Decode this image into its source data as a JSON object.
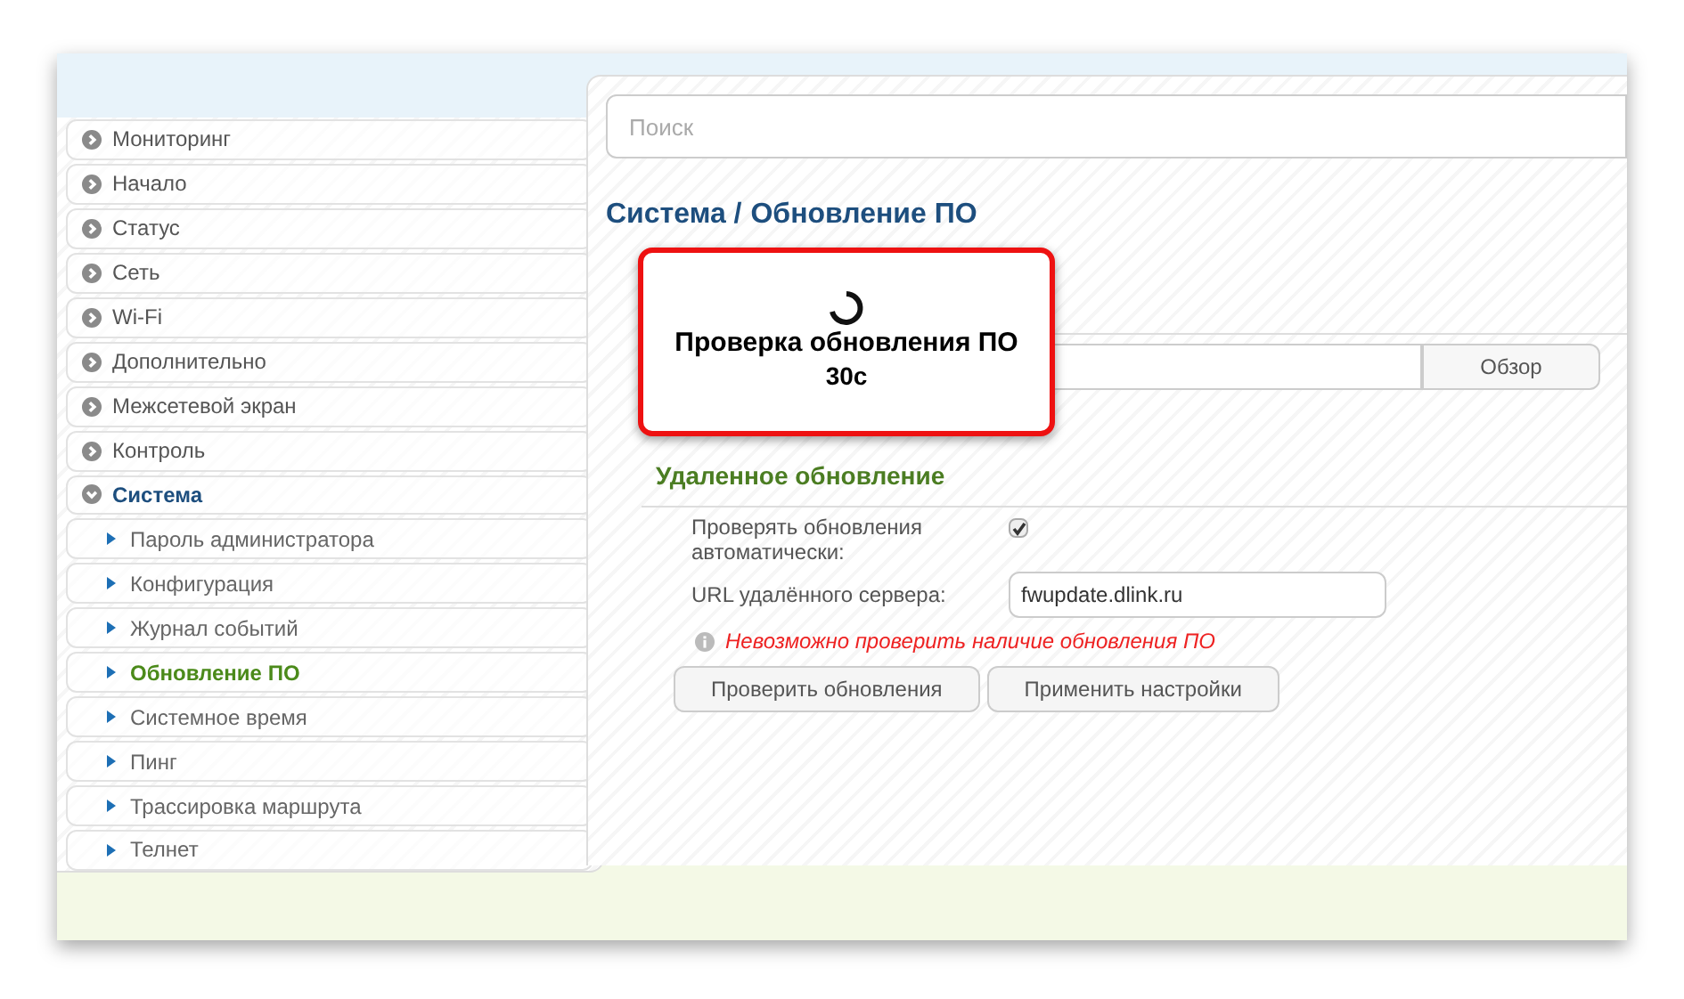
{
  "sidebar": {
    "items": [
      {
        "label": "Мониторинг",
        "selected": false,
        "expanded": false
      },
      {
        "label": "Начало",
        "selected": false,
        "expanded": false
      },
      {
        "label": "Статус",
        "selected": false,
        "expanded": false
      },
      {
        "label": "Сеть",
        "selected": false,
        "expanded": false
      },
      {
        "label": "Wi-Fi",
        "selected": false,
        "expanded": false
      },
      {
        "label": "Дополнительно",
        "selected": false,
        "expanded": false
      },
      {
        "label": "Межсетевой экран",
        "selected": false,
        "expanded": false
      },
      {
        "label": "Контроль",
        "selected": false,
        "expanded": false
      },
      {
        "label": "Система",
        "selected": true,
        "expanded": true,
        "children": [
          {
            "label": "Пароль администратора",
            "selected": false
          },
          {
            "label": "Конфигурация",
            "selected": false
          },
          {
            "label": "Журнал событий",
            "selected": false
          },
          {
            "label": "Обновление ПО",
            "selected": true
          },
          {
            "label": "Системное время",
            "selected": false
          },
          {
            "label": "Пинг",
            "selected": false
          },
          {
            "label": "Трассировка маршрута",
            "selected": false
          },
          {
            "label": "Телнет",
            "selected": false
          }
        ]
      }
    ]
  },
  "search": {
    "placeholder": "Поиск"
  },
  "breadcrumb": [
    "Система /",
    "Обновление ПО"
  ],
  "local_update": {
    "browse_button": "Обзор"
  },
  "remote_update": {
    "title": "Удаленное обновление",
    "auto_check_label": "Проверять обновления автоматически:",
    "auto_check": true,
    "server_label": "URL удалённого сервера:",
    "server_value": "fwupdate.dlink.ru",
    "error": "Невозможно проверить наличие обновления ПО",
    "buttons": [
      "Проверить обновления",
      "Применить настройки"
    ]
  },
  "dialog": {
    "message": "Проверка обновления ПО",
    "countdown": "30с"
  }
}
